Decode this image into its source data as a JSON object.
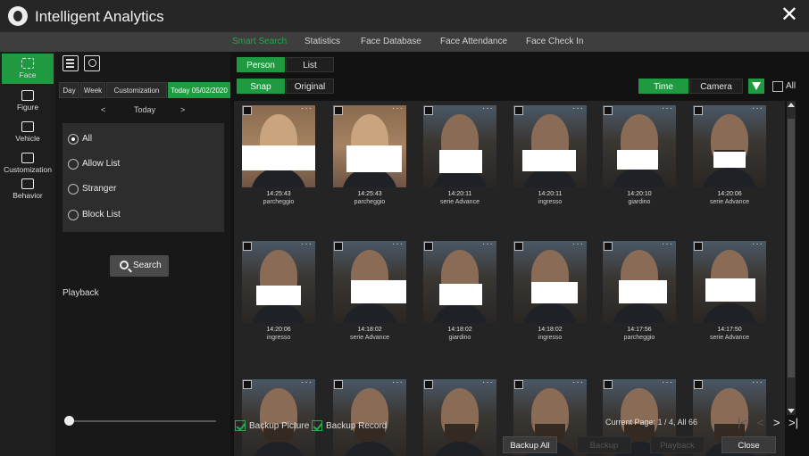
{
  "app": {
    "title": "Intelligent Analytics",
    "close_label": "✕"
  },
  "tabs": [
    {
      "label": "Smart Search",
      "active": true
    },
    {
      "label": "Statistics"
    },
    {
      "label": "Face Database"
    },
    {
      "label": "Face Attendance"
    },
    {
      "label": "Face Check In"
    }
  ],
  "leftnav": [
    {
      "label": "Face",
      "icon": "face-icon",
      "active": true
    },
    {
      "label": "Figure",
      "icon": "figure-icon"
    },
    {
      "label": "Vehicle",
      "icon": "vehicle-icon"
    },
    {
      "label": "Customization",
      "icon": "customization-icon"
    },
    {
      "label": "Behavior",
      "icon": "behavior-icon"
    }
  ],
  "filters": {
    "date_buttons": [
      "Day",
      "Week",
      "Customization",
      "Today 05/02/2020"
    ],
    "nav_prev": "<",
    "today_label": "Today",
    "nav_next": ">",
    "options": [
      {
        "label": "All",
        "checked": true
      },
      {
        "label": "Allow List"
      },
      {
        "label": "Stranger"
      },
      {
        "label": "Block List"
      }
    ],
    "search_label": "Search",
    "playback_label": "Playback"
  },
  "main": {
    "view_toggle": [
      "Person",
      "List"
    ],
    "image_toggle": [
      "Snap",
      "Original"
    ],
    "sort_toggle": [
      "Time",
      "Camera"
    ],
    "all_label": "All",
    "results": [
      {
        "time": "14:25:43",
        "location": "parcheggio"
      },
      {
        "time": "14:25:43",
        "location": "parcheggio"
      },
      {
        "time": "14:20:11",
        "location": "serie Advance"
      },
      {
        "time": "14:20:11",
        "location": "ingresso"
      },
      {
        "time": "14:20:10",
        "location": "giardino"
      },
      {
        "time": "14:20:06",
        "location": "serie Advance"
      },
      {
        "time": "14:20:06",
        "location": "ingresso"
      },
      {
        "time": "14:18:02",
        "location": "serie Advance"
      },
      {
        "time": "14:18:02",
        "location": "giardino"
      },
      {
        "time": "14:18:02",
        "location": "ingresso"
      },
      {
        "time": "14:17:56",
        "location": "parcheggio"
      },
      {
        "time": "14:17:50",
        "location": "serie Advance"
      },
      {
        "time": "",
        "location": ""
      },
      {
        "time": "",
        "location": ""
      },
      {
        "time": "",
        "location": ""
      },
      {
        "time": "",
        "location": ""
      },
      {
        "time": "",
        "location": ""
      },
      {
        "time": "",
        "location": ""
      }
    ],
    "backup_picture_label": "Backup Picture",
    "backup_record_label": "Backup Record",
    "page_info": "Current Page: 1 / 4, All 66",
    "pager": [
      "|<",
      "<",
      ">",
      ">|"
    ],
    "buttons": [
      {
        "label": "Backup All",
        "enabled": true
      },
      {
        "label": "Backup",
        "enabled": false
      },
      {
        "label": "Playback",
        "enabled": false
      },
      {
        "label": "Close",
        "enabled": true
      }
    ]
  },
  "colors": {
    "accent": "#1f9a40",
    "background": "#141414",
    "panel": "#2d2d2d"
  }
}
